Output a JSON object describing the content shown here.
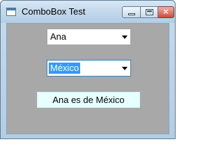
{
  "window": {
    "title": "ComboBox Test",
    "close_glyph": "✕"
  },
  "combo_name": {
    "value": "Ana"
  },
  "combo_country": {
    "value": "México"
  },
  "result": {
    "text": "Ana es de México"
  }
}
